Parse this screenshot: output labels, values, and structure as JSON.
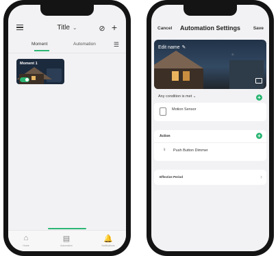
{
  "left_phone": {
    "header": {
      "title": "Title",
      "title_chevron": "⌄",
      "menu_icon": "hamburger-icon",
      "lock_icon": "⊘",
      "add_icon": "+"
    },
    "tabs": [
      {
        "label": "Moment",
        "active": true
      },
      {
        "label": "Automation",
        "active": false
      }
    ],
    "sort_icon": "☰",
    "moment_card": {
      "title": "Moment 1",
      "toggle_on": true
    },
    "tabbar": [
      {
        "icon": "⌂",
        "label": "Home"
      },
      {
        "icon": "▤",
        "label": "Automation"
      },
      {
        "icon": "🔔",
        "label": "Notifications"
      }
    ],
    "accent_color": "#2bb673"
  },
  "right_phone": {
    "header": {
      "cancel": "Cancel",
      "title": "Automation Settings",
      "save": "Save"
    },
    "hero": {
      "edit_name": "Edit name",
      "pencil": "✎"
    },
    "condition": {
      "label": "Any condition is met",
      "chevron": "⌄",
      "add": "+"
    },
    "sensor": {
      "title": "Motion Sensor"
    },
    "action": {
      "label": "Action",
      "add": "+",
      "item_title": "Push Button Dimmer"
    },
    "period": {
      "label": "Effective Period",
      "chevron": "›"
    }
  }
}
